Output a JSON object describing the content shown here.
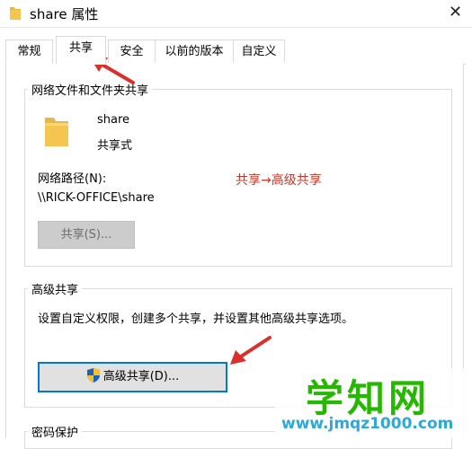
{
  "window": {
    "title": "share 属性",
    "close_glyph": "✕"
  },
  "tabs": [
    {
      "label": "常规"
    },
    {
      "label": "共享",
      "active": true
    },
    {
      "label": "安全"
    },
    {
      "label": "以前的版本"
    },
    {
      "label": "自定义"
    }
  ],
  "network_sharing": {
    "group_title": "网络文件和文件夹共享",
    "folder_name": "share",
    "folder_state": "共享式",
    "path_label": "网络路径(N):",
    "path_value": "\\\\RICK-OFFICE\\share",
    "share_button": "共享(S)...",
    "annotation": "共享→高级共享"
  },
  "advanced_sharing": {
    "group_title": "高级共享",
    "description": "设置自定义权限，创建多个共享，并设置其他高级共享选项。",
    "button_label": "高级共享(D)..."
  },
  "password_section": {
    "group_title": "密码保护"
  },
  "watermark": {
    "title": "学知网",
    "url": "www.jmqz1000.com"
  },
  "colors": {
    "accent": "#0078d7",
    "annotation": "#c0392b",
    "watermark_green": "#26b800",
    "watermark_blue": "#2ea8d6",
    "arrow_red": "#d9302c",
    "folder": "#f4c64f"
  },
  "icons": [
    "folder-icon",
    "shield-icon",
    "close-icon"
  ]
}
